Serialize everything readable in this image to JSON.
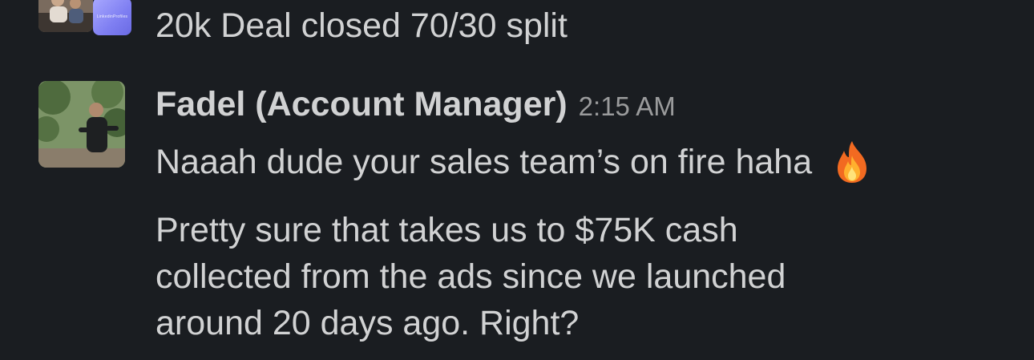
{
  "previous_message": {
    "text": "20k Deal closed 70/30 split",
    "app_logo_text": "LinkedinProfiles"
  },
  "message": {
    "author": "Fadel (Account Manager)",
    "timestamp": "2:15 AM",
    "line1": "Naaah dude your sales team’s on fire haha",
    "line1_emoji": "fire-emoji",
    "paragraph_lines": [
      "Pretty sure that takes us to $75K cash",
      "collected from the ads since we launched",
      "around 20 days ago. Right?"
    ]
  },
  "colors": {
    "background": "#1a1d21",
    "text": "#d1d2d3",
    "timestamp": "#9a9b9c",
    "app_avatar": "#8b8bf5"
  }
}
